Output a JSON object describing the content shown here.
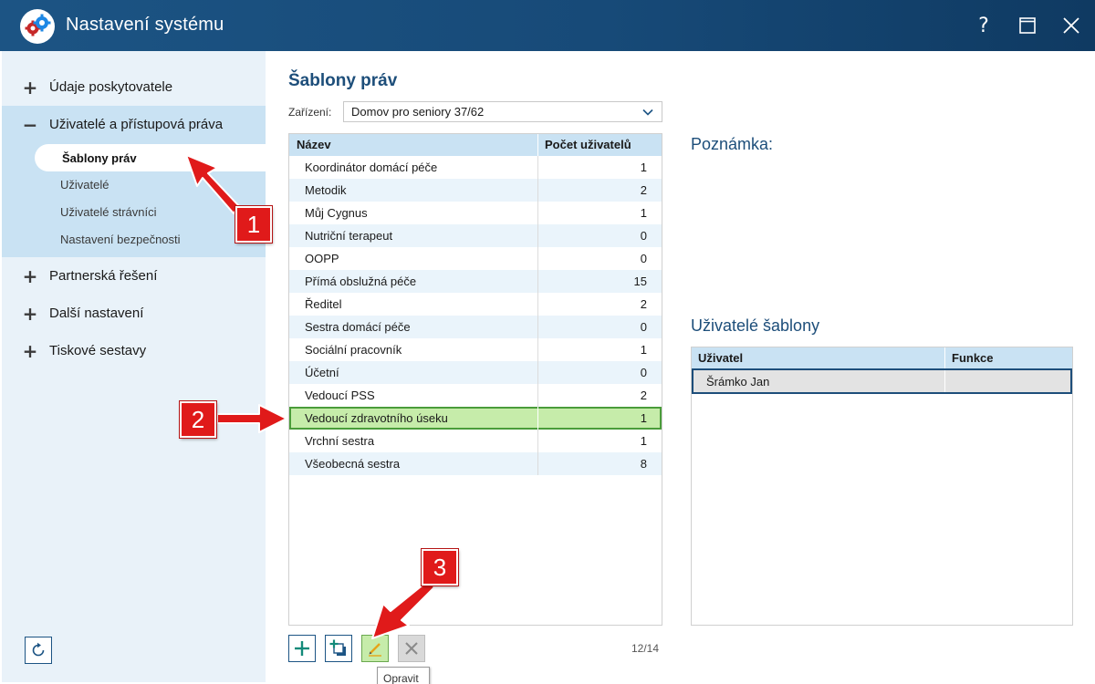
{
  "window": {
    "title": "Nastavení systému",
    "help": "?"
  },
  "sidebar": {
    "groups": [
      {
        "label": "Údaje poskytovatele",
        "toggle": "+"
      },
      {
        "label": "Uživatelé a přístupová práva",
        "toggle": "−"
      },
      {
        "label": "Partnerská řešení",
        "toggle": "+"
      },
      {
        "label": "Další nastavení",
        "toggle": "+"
      },
      {
        "label": "Tiskové sestavy",
        "toggle": "+"
      }
    ],
    "subitems": [
      {
        "label": "Šablony práv"
      },
      {
        "label": "Uživatelé"
      },
      {
        "label": "Uživatelé strávníci"
      },
      {
        "label": "Nastavení bezpečnosti"
      }
    ]
  },
  "main": {
    "title": "Šablony práv",
    "facility_label": "Zařízení:",
    "facility_value": "Domov pro seniory 37/62",
    "table": {
      "col_name": "Název",
      "col_count": "Počet uživatelů",
      "rows": [
        {
          "name": "Koordinátor domácí péče",
          "count": "1"
        },
        {
          "name": "Metodik",
          "count": "2"
        },
        {
          "name": "Můj Cygnus",
          "count": "1"
        },
        {
          "name": "Nutriční terapeut",
          "count": "0"
        },
        {
          "name": "OOPP",
          "count": "0"
        },
        {
          "name": "Přímá obslužná péče",
          "count": "15"
        },
        {
          "name": "Ředitel",
          "count": "2"
        },
        {
          "name": "Sestra domácí péče",
          "count": "0"
        },
        {
          "name": "Sociální pracovník",
          "count": "1"
        },
        {
          "name": "Účetní",
          "count": "0"
        },
        {
          "name": "Vedoucí PSS",
          "count": "2"
        },
        {
          "name": "Vedoucí zdravotního úseku",
          "count": "1"
        },
        {
          "name": "Vrchní sestra",
          "count": "1"
        },
        {
          "name": "Všeobecná sestra",
          "count": "8"
        }
      ],
      "selected_index": 11
    },
    "counter": "12/14",
    "tooltip": "Opravit"
  },
  "right": {
    "note_label": "Poznámka:",
    "users_label": "Uživatelé šablony",
    "users_table": {
      "col_user": "Uživatel",
      "col_function": "Funkce",
      "rows": [
        {
          "user": "Šrámko Jan",
          "function": ""
        }
      ]
    }
  },
  "annotations": {
    "badge1": "1",
    "badge2": "2",
    "badge3": "3"
  },
  "colors": {
    "titlebar": "#174a78",
    "accent": "#1d4e7a",
    "selected_row": "#c6ecaa",
    "annotation_red": "#e01a1a"
  }
}
